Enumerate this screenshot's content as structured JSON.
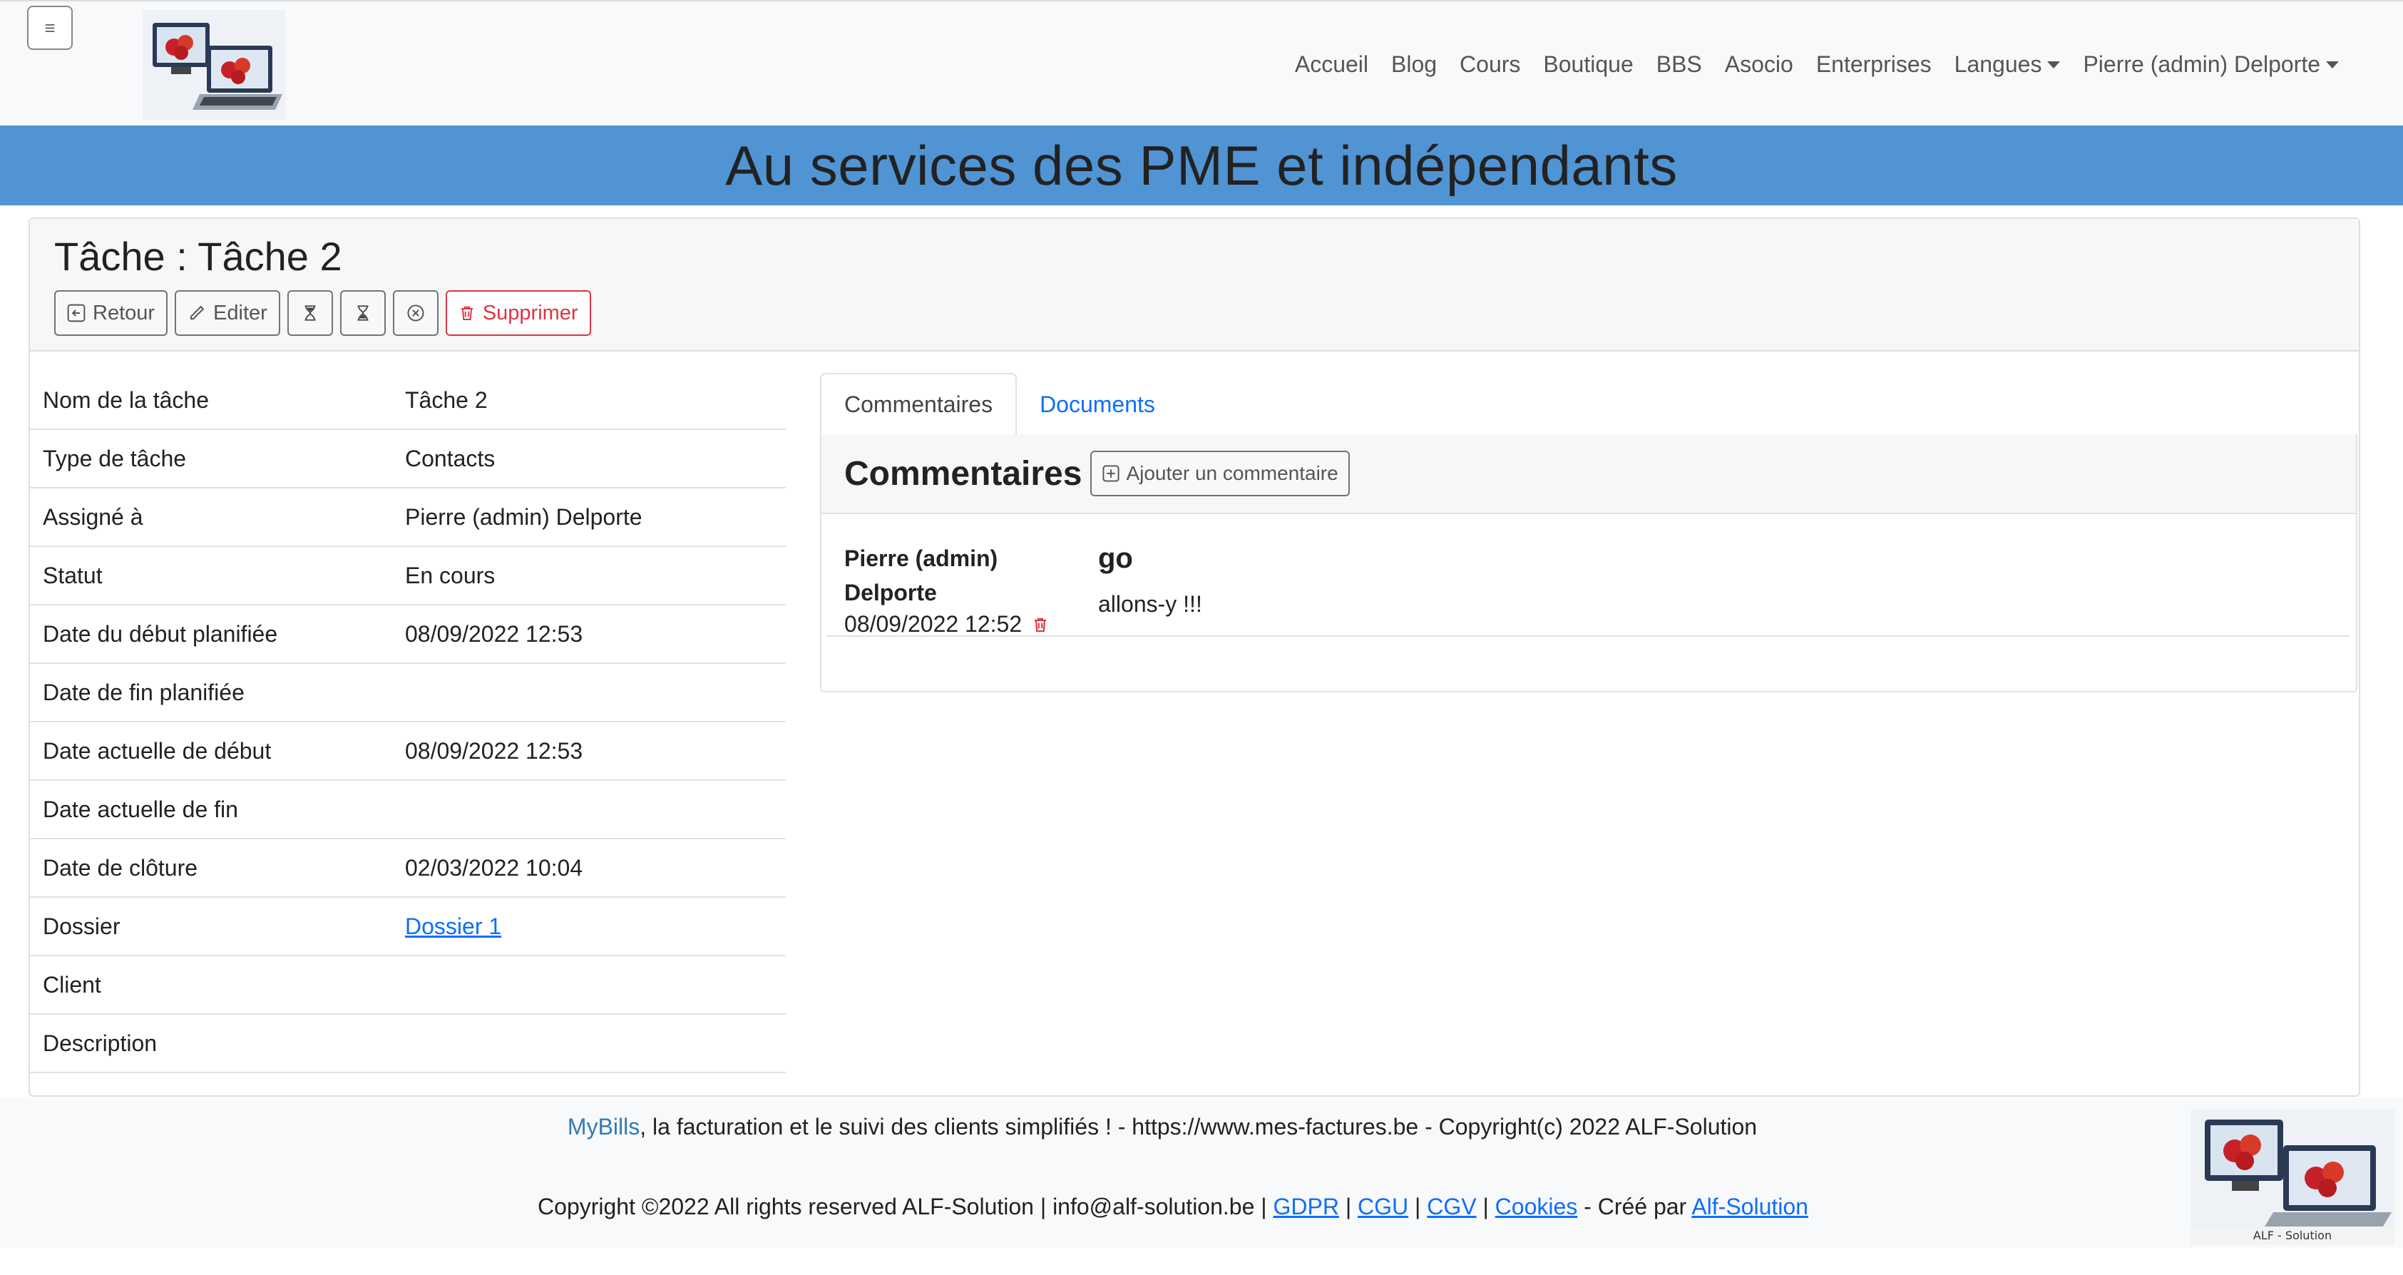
{
  "nav": {
    "links": [
      "Accueil",
      "Blog",
      "Cours",
      "Boutique",
      "BBS",
      "Asocio",
      "Enterprises"
    ],
    "dropdowns": [
      "Langues",
      "Pierre (admin) Delporte"
    ]
  },
  "banner": {
    "title": "Au services des PME et indépendants"
  },
  "task": {
    "heading": "Tâche : Tâche 2",
    "toolbar": {
      "back": "Retour",
      "edit": "Editer",
      "delete": "Supprimer"
    },
    "details": [
      {
        "label": "Nom de la tâche",
        "value": "Tâche 2"
      },
      {
        "label": "Type de tâche",
        "value": "Contacts"
      },
      {
        "label": "Assigné à",
        "value": "Pierre (admin) Delporte"
      },
      {
        "label": "Statut",
        "value": "En cours"
      },
      {
        "label": "Date du début planifiée",
        "value": "08/09/2022 12:53"
      },
      {
        "label": "Date de fin planifiée",
        "value": ""
      },
      {
        "label": "Date actuelle de début",
        "value": "08/09/2022 12:53"
      },
      {
        "label": "Date actuelle de fin",
        "value": ""
      },
      {
        "label": "Date de clôture",
        "value": "02/03/2022 10:04"
      },
      {
        "label": "Dossier",
        "value": "Dossier 1",
        "link": true
      },
      {
        "label": "Client",
        "value": ""
      },
      {
        "label": "Description",
        "value": ""
      }
    ]
  },
  "tabs": {
    "comments": "Commentaires",
    "documents": "Documents"
  },
  "comments": {
    "heading": "Commentaires",
    "add_label": "Ajouter un commentaire",
    "items": [
      {
        "author_line1": "Pierre (admin)",
        "author_line2": "Delporte",
        "date": "08/09/2022 12:52",
        "title": "go",
        "text": "allons-y !!!"
      }
    ]
  },
  "footer": {
    "brand": "MyBills",
    "line1": ", la facturation et le suivi des clients simplifiés ! - https://www.mes-factures.be - Copyright(c) 2022 ALF-Solution",
    "line2_prefix": "Copyright ©2022 All rights reserved ALF-Solution | info@alf-solution.be | ",
    "links": {
      "gdpr": "GDPR",
      "cgu": "CGU",
      "cgv": "CGV",
      "cookies": "Cookies",
      "author": "Alf-Solution"
    },
    "sep": " | ",
    "created_by": " - Créé par ",
    "logo_caption": "ALF - Solution"
  },
  "colors": {
    "banner": "#5094d4",
    "link": "#0d6efd",
    "danger": "#dc3545",
    "brand": "#337ab7"
  }
}
